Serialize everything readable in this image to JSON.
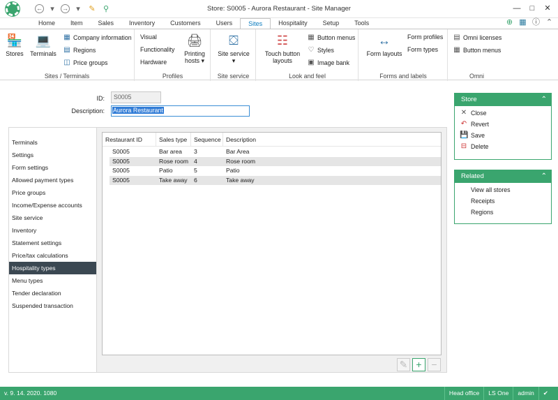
{
  "window": {
    "title": "Store: S0005 - Aurora Restaurant - Site Manager"
  },
  "tabs": [
    {
      "label": "Home"
    },
    {
      "label": "Item"
    },
    {
      "label": "Sales"
    },
    {
      "label": "Inventory"
    },
    {
      "label": "Customers"
    },
    {
      "label": "Users"
    },
    {
      "label": "Sites",
      "active": true
    },
    {
      "label": "Hospitality"
    },
    {
      "label": "Setup"
    },
    {
      "label": "Tools"
    }
  ],
  "ribbon": {
    "sites_terminals": {
      "label": "Sites / Terminals",
      "stores": "Stores",
      "terminals": "Terminals",
      "company_information": "Company information",
      "regions": "Regions",
      "price_groups": "Price groups"
    },
    "profiles": {
      "label": "Profiles",
      "visual": "Visual",
      "functionality": "Functionality",
      "hardware": "Hardware",
      "printing_hosts_1": "Printing",
      "printing_hosts_2": "hosts"
    },
    "site_service": {
      "label": "Site service",
      "btn": "Site service"
    },
    "look_and_feel": {
      "label": "Look and feel",
      "touch_1": "Touch button",
      "touch_2": "layouts",
      "button_menus": "Button menus",
      "styles": "Styles",
      "image_bank": "Image bank"
    },
    "forms": {
      "label": "Forms and labels",
      "form_layouts": "Form layouts",
      "form_profiles": "Form profiles",
      "form_types": "Form types"
    },
    "omni": {
      "label": "Omni",
      "omni_licenses": "Omni licenses",
      "button_menus": "Button menus"
    }
  },
  "form": {
    "id_label": "ID:",
    "id_value": "S0005",
    "desc_label": "Description:",
    "desc_value": "Aurora Restaurant"
  },
  "nav": [
    "Terminals",
    "Settings",
    "Form settings",
    "Allowed payment types",
    "Price groups",
    "Income/Expense accounts",
    "Site service",
    "Inventory",
    "Statement settings",
    "Price/tax calculations",
    "Hospitality types",
    "Menu types",
    "Tender declaration",
    "Suspended transaction"
  ],
  "nav_active": "Hospitality types",
  "grid": {
    "headers": [
      "Restaurant ID",
      "Sales type",
      "Sequence",
      "Description"
    ],
    "rows": [
      [
        "S0005",
        "Bar area",
        "3",
        "Bar Area"
      ],
      [
        "S0005",
        "Rose room",
        "4",
        "Rose room"
      ],
      [
        "S0005",
        "Patio",
        "5",
        "Patio"
      ],
      [
        "S0005",
        "Take away",
        "6",
        "Take away"
      ]
    ]
  },
  "store_panel": {
    "title": "Store",
    "items": [
      "Close",
      "Revert",
      "Save",
      "Delete"
    ]
  },
  "related_panel": {
    "title": "Related",
    "items": [
      "View all stores",
      "Receipts",
      "Regions"
    ]
  },
  "status": {
    "version": "v. 9. 14. 2020. 1080",
    "office": "Head office",
    "product": "LS One",
    "user": "admin"
  },
  "colors": {
    "accent": "#3aa56e",
    "nav_active": "#3b4852",
    "selection": "#2f7bd6"
  }
}
